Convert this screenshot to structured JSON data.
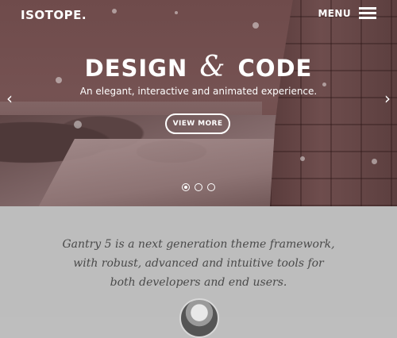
{
  "header": {
    "logo": "ISOTOPE.",
    "menu_label": "MENU",
    "menu_icon": "hamburger-icon"
  },
  "hero": {
    "title_part1": "DESIGN",
    "title_amp": "&",
    "title_part2": "CODE",
    "subtitle": "An elegant, interactive and animated experience.",
    "cta_label": "VIEW MORE",
    "prev_icon": "chevron-left-icon",
    "next_icon": "chevron-right-icon",
    "prev_glyph": "‹",
    "next_glyph": "›",
    "slides": {
      "count": 3,
      "active_index": 0
    }
  },
  "intro": {
    "line1": "Gantry 5 is a next generation theme framework,",
    "line2": "with robust, advanced and intuitive tools for",
    "line3": "both developers and end users."
  },
  "colors": {
    "hero_tint": "#6f4b4b",
    "intro_bg": "#bdbdbd",
    "intro_text": "#4a4a4a",
    "text_on_hero": "#ffffff"
  }
}
